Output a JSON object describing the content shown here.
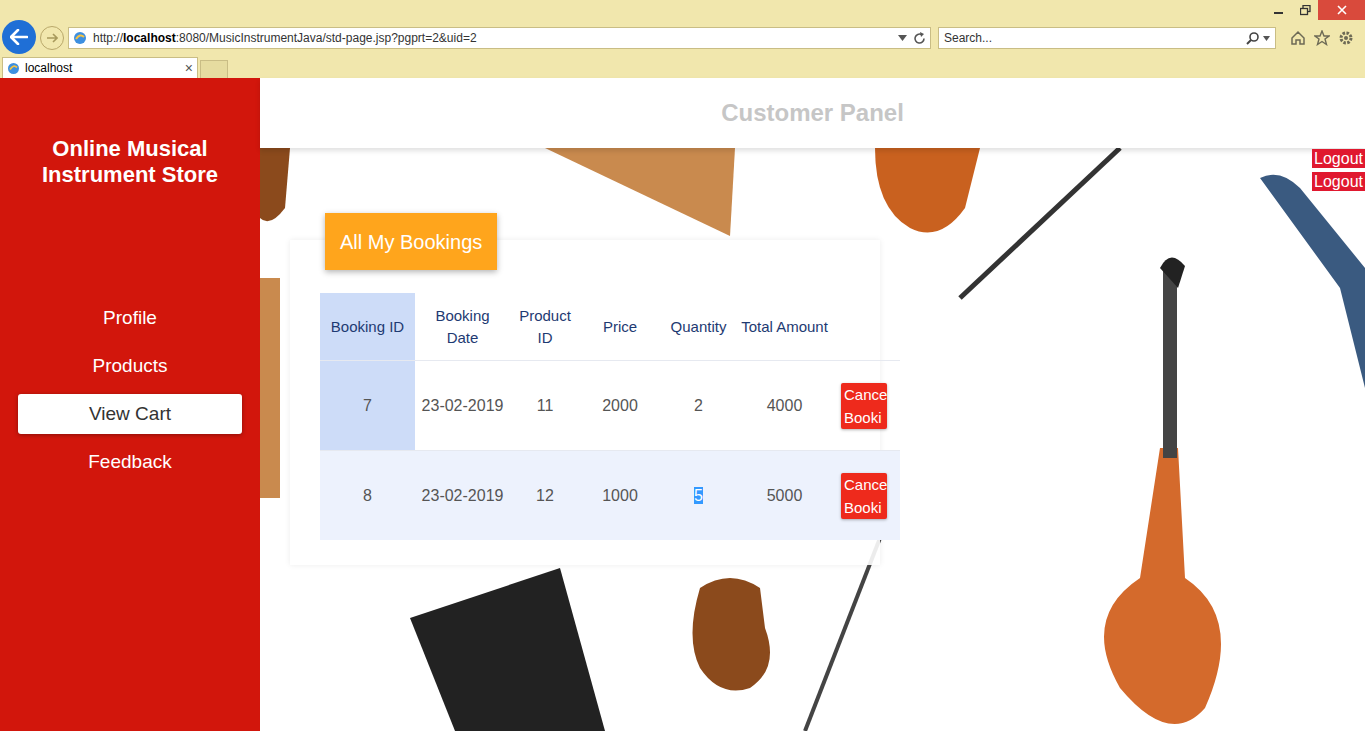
{
  "browser": {
    "address": {
      "scheme": "http://",
      "host": "localhost",
      "path": ":8080/MusicInstrumentJava/std-page.jsp?pgprt=2&uid=2"
    },
    "search": {
      "placeholder": "Search..."
    },
    "tabs": [
      {
        "label": "localhost",
        "close": "×",
        "selected": true
      }
    ]
  },
  "sidebar": {
    "title": "Online Musical Instrument Store",
    "items": [
      {
        "label": "Profile",
        "selected": false
      },
      {
        "label": "Products",
        "selected": false
      },
      {
        "label": "View Cart",
        "selected": true
      },
      {
        "label": "Feedback",
        "selected": false
      }
    ]
  },
  "header": {
    "title": "Customer Panel"
  },
  "logout_buttons": [
    "Logout",
    "Logout"
  ],
  "bookings_button": "All My Bookings",
  "table": {
    "columns": [
      {
        "label": "Booking ID",
        "highlighted": true
      },
      {
        "label": "Booking Date",
        "highlighted": false
      },
      {
        "label": "Product ID",
        "highlighted": false
      },
      {
        "label": "Price",
        "highlighted": false
      },
      {
        "label": "Quantity",
        "highlighted": false
      },
      {
        "label": "Total Amount",
        "highlighted": false
      }
    ],
    "rows": [
      {
        "hovered": false,
        "cells": [
          "7",
          "23-02-2019",
          "11",
          "2000",
          "2",
          "4000"
        ],
        "cell_selected": [
          false,
          false,
          false,
          false,
          false,
          false
        ],
        "action": "Cance\nBooki"
      },
      {
        "hovered": true,
        "cells": [
          "8",
          "23-02-2019",
          "12",
          "1000",
          "5",
          "5000"
        ],
        "cell_selected": [
          false,
          false,
          false,
          false,
          true,
          false
        ],
        "action": "Cance\nBooki"
      }
    ]
  }
}
